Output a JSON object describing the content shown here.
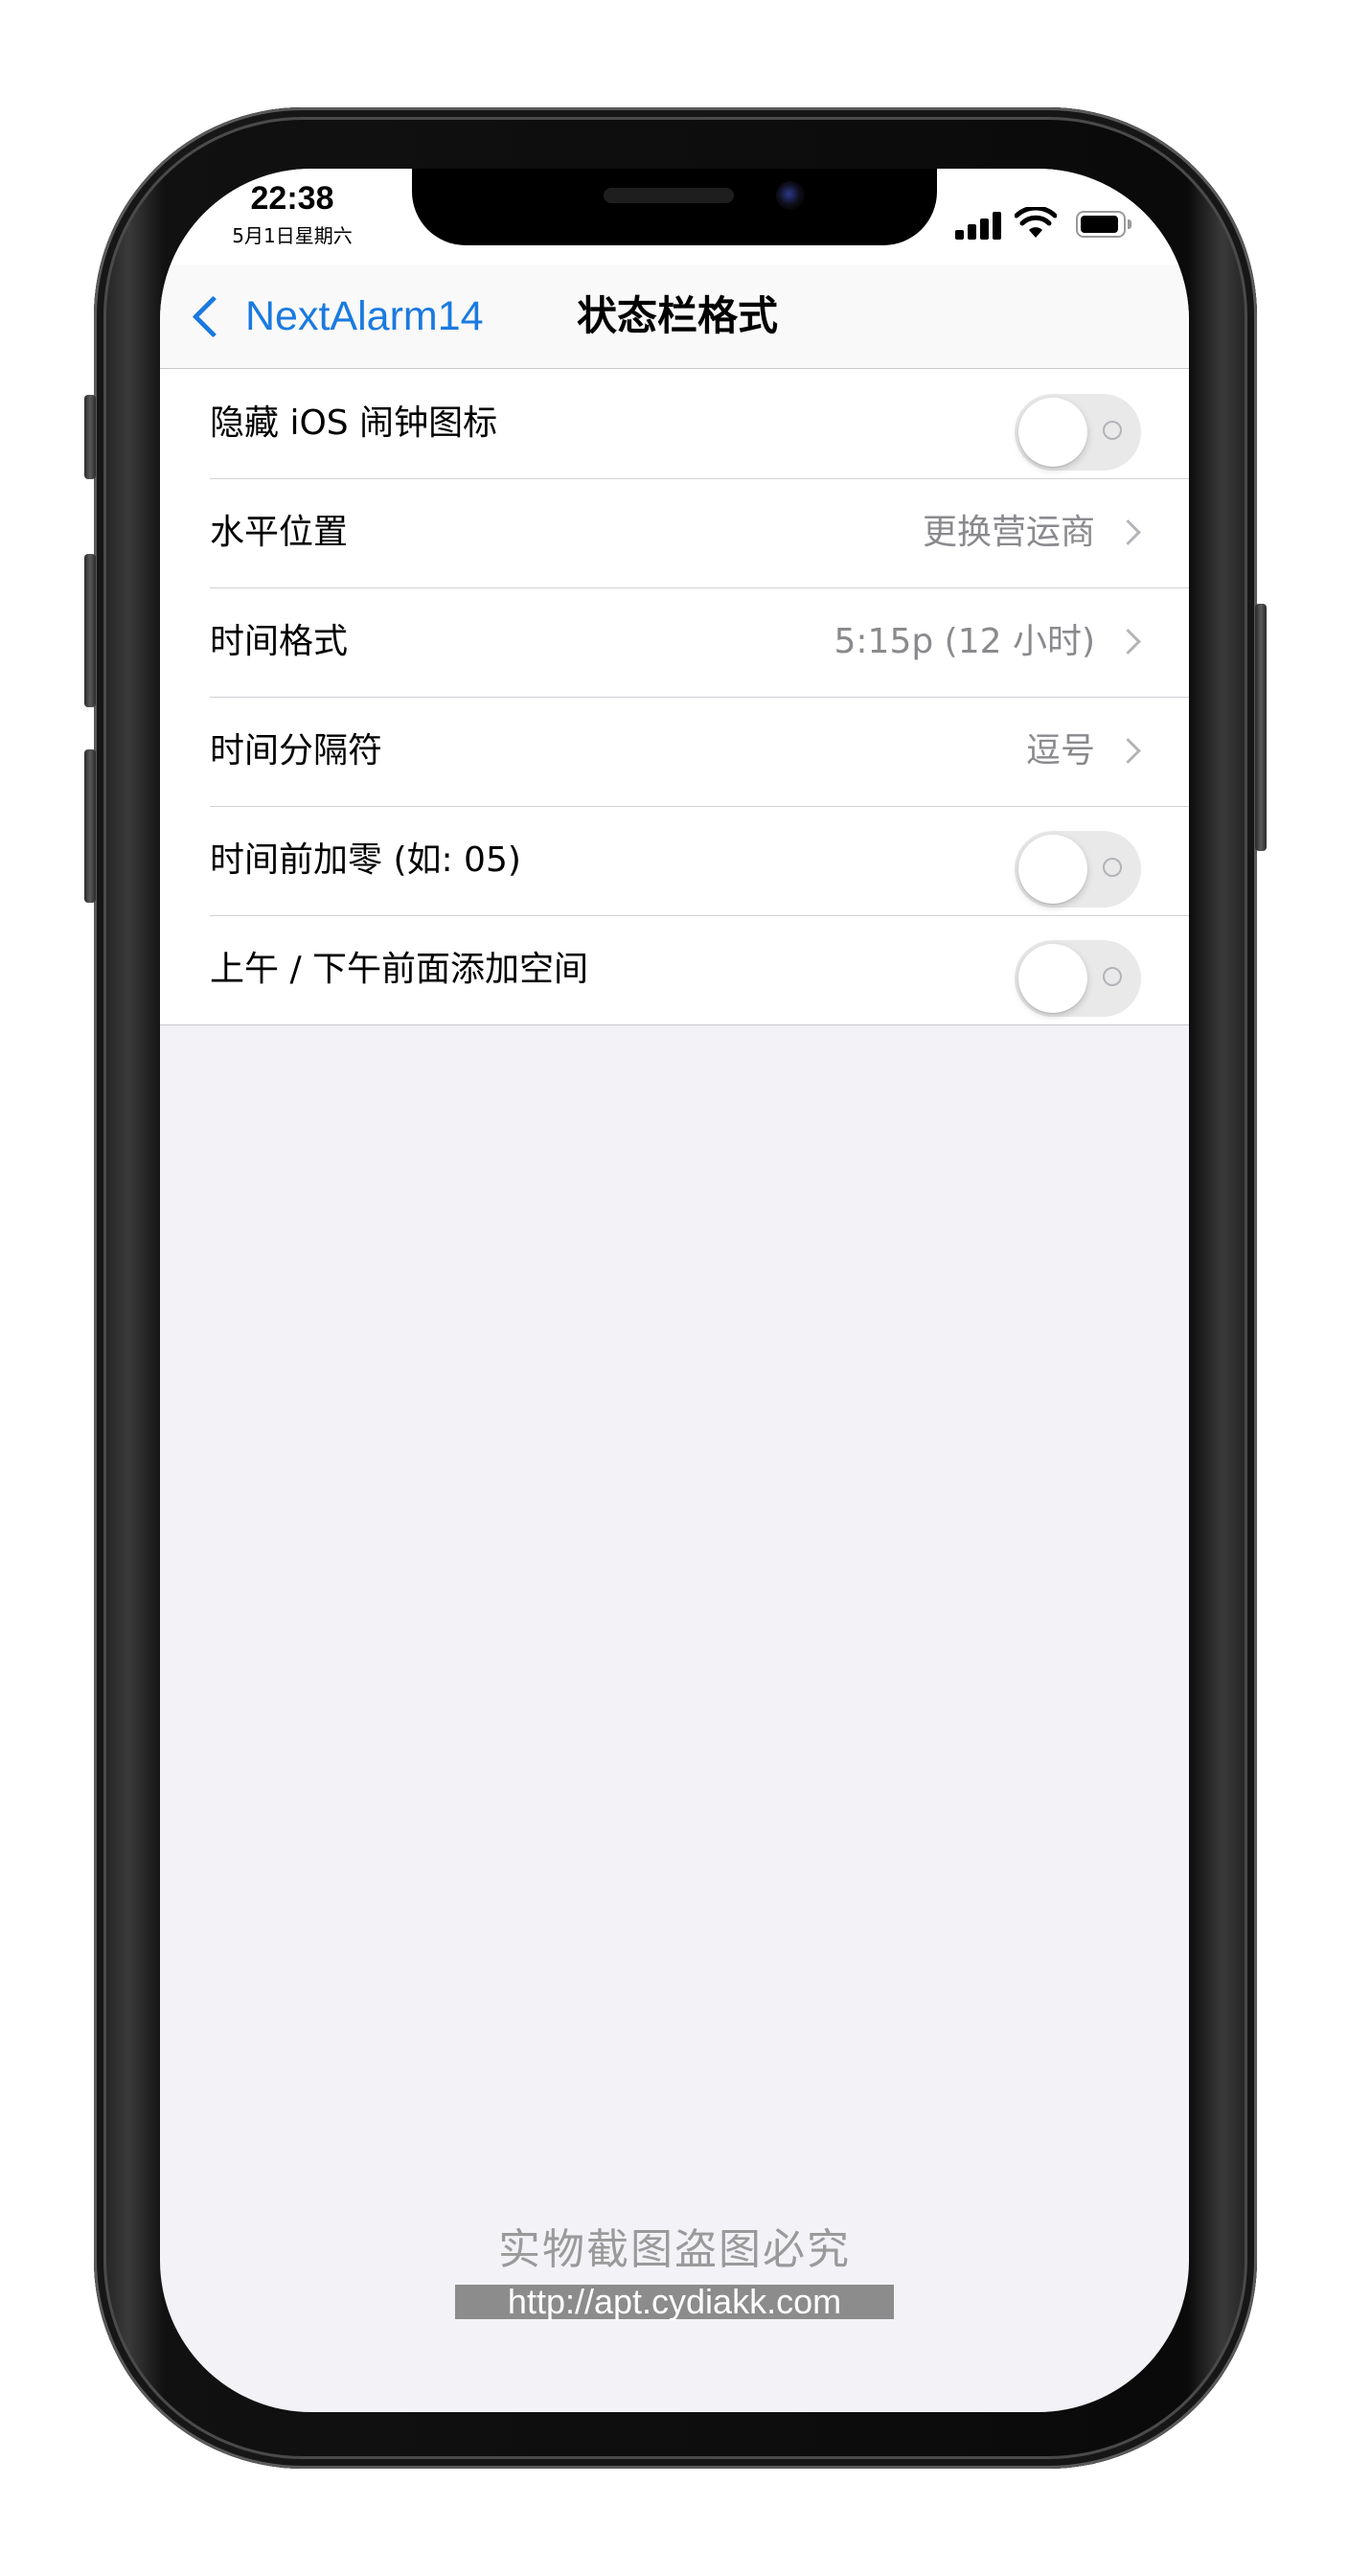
{
  "status_bar": {
    "time": "22:38",
    "date": "5月1日星期六",
    "signal_icon": "cellular-signal-icon",
    "wifi_icon": "wifi-icon",
    "battery_icon": "battery-icon"
  },
  "nav": {
    "back_label": "NextAlarm14",
    "title": "状态栏格式"
  },
  "settings": [
    {
      "label": "隐藏 iOS 闹钟图标",
      "type": "toggle",
      "on": false
    },
    {
      "label": "水平位置",
      "type": "link",
      "value": "更换营运商"
    },
    {
      "label": "时间格式",
      "type": "link",
      "value": "5:15p (12 小时)"
    },
    {
      "label": "时间分隔符",
      "type": "link",
      "value": "逗号"
    },
    {
      "label": "时间前加零 (如: 05)",
      "type": "toggle",
      "on": false
    },
    {
      "label": "上午 / 下午前面添加空间",
      "type": "toggle",
      "on": false
    }
  ],
  "watermark": {
    "text": "实物截图盗图必究",
    "url": "http://apt.cydiakk.com"
  },
  "colors": {
    "accent": "#1a7ae0",
    "background": "#f2f2f7",
    "toggle_off": "#e9e9ea",
    "secondary_text": "#8a8a8e"
  }
}
